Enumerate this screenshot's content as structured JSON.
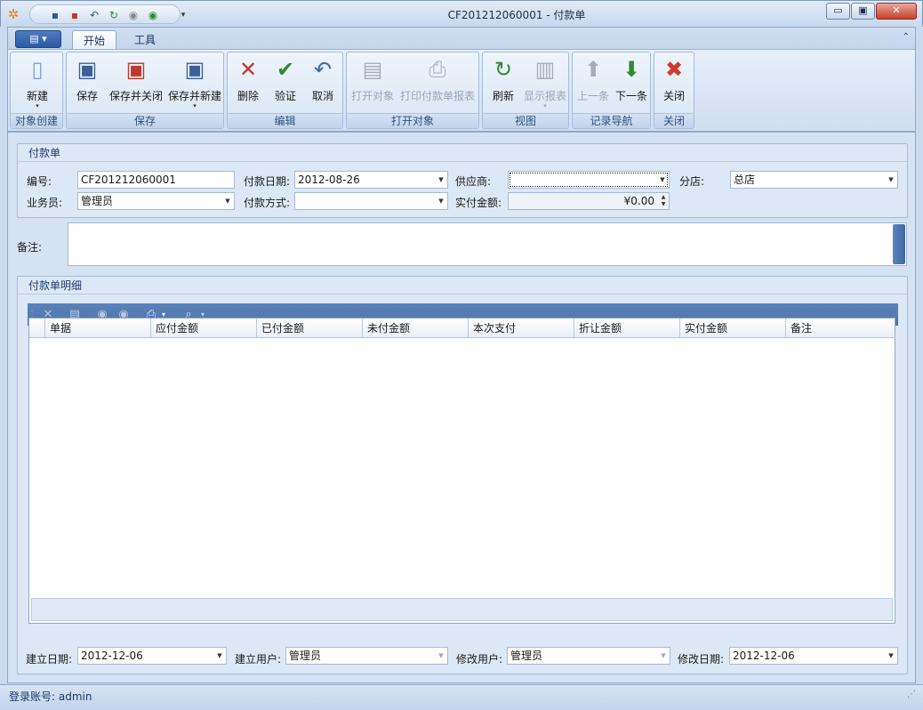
{
  "window": {
    "title": "CF201212060001 - 付款单",
    "minimize_glyph": "▭",
    "maximize_glyph": "▣",
    "close_glyph": "✕"
  },
  "quick_access": [
    "save-icon",
    "save-close-icon",
    "undo-icon",
    "refresh-icon",
    "up-icon",
    "down-icon",
    "customize-icon"
  ],
  "tabs": [
    "开始",
    "工具"
  ],
  "ribbon": {
    "groups": [
      {
        "title": "对象创建",
        "buttons": [
          {
            "label": "新建",
            "icon": "new-doc-icon",
            "enabled": true
          }
        ]
      },
      {
        "title": "保存",
        "buttons": [
          {
            "label": "保存",
            "icon": "save-icon",
            "enabled": true
          },
          {
            "label": "保存并关闭",
            "icon": "save-close-icon",
            "enabled": true
          },
          {
            "label": "保存并新建",
            "icon": "save-new-icon",
            "enabled": true
          }
        ]
      },
      {
        "title": "编辑",
        "buttons": [
          {
            "label": "删除",
            "icon": "delete-icon",
            "enabled": true
          },
          {
            "label": "验证",
            "icon": "check-icon",
            "enabled": true
          },
          {
            "label": "取消",
            "icon": "undo-icon",
            "enabled": true
          }
        ]
      },
      {
        "title": "打开对象",
        "buttons": [
          {
            "label": "打开对象",
            "icon": "open-object-icon",
            "enabled": false
          },
          {
            "label": "打印付款单报表",
            "icon": "printer-icon",
            "enabled": false
          }
        ]
      },
      {
        "title": "视图",
        "buttons": [
          {
            "label": "刷新",
            "icon": "refresh-icon",
            "enabled": true
          },
          {
            "label": "显示报表",
            "icon": "report-icon",
            "enabled": false
          }
        ]
      },
      {
        "title": "记录导航",
        "buttons": [
          {
            "label": "上一条",
            "icon": "up-arrow-icon",
            "enabled": false
          },
          {
            "label": "下一条",
            "icon": "down-arrow-icon",
            "enabled": true
          }
        ]
      },
      {
        "title": "关闭",
        "buttons": [
          {
            "label": "关闭",
            "icon": "close-red-icon",
            "enabled": true
          }
        ]
      }
    ]
  },
  "header_section": {
    "title": "付款单",
    "number_label": "编号:",
    "number_value": "CF201212060001",
    "pay_date_label": "付款日期:",
    "pay_date_value": "2012-08-26",
    "supplier_label": "供应商:",
    "supplier_value": "",
    "branch_label": "分店:",
    "branch_value": "总店",
    "salesman_label": "业务员:",
    "salesman_value": "管理员",
    "pay_method_label": "付款方式:",
    "pay_method_value": "",
    "paid_amount_label": "实付金额:",
    "paid_amount_value": "¥0.00"
  },
  "remark": {
    "label": "备注:",
    "value": ""
  },
  "detail_section": {
    "title": "付款单明细",
    "columns": [
      "单据",
      "应付金额",
      "已付金额",
      "未付金额",
      "本次支付",
      "折让金额",
      "实付金额",
      "备注"
    ],
    "rows": []
  },
  "footer_fields": {
    "created_date_label": "建立日期:",
    "created_date_value": "2012-12-06",
    "created_user_label": "建立用户:",
    "created_user_value": "管理员",
    "modified_user_label": "修改用户:",
    "modified_user_value": "管理员",
    "modified_date_label": "修改日期:",
    "modified_date_value": "2012-12-06"
  },
  "status": {
    "login": "登录账号: admin"
  }
}
